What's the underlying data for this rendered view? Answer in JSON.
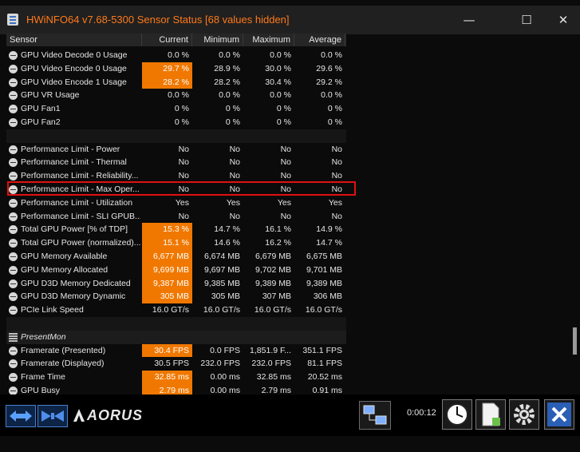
{
  "window": {
    "title": "HWiNFO64 v7.68-5300 Sensor Status [68 values hidden]",
    "minimize_glyph": "—",
    "maximize_glyph": "☐",
    "close_glyph": "✕"
  },
  "table": {
    "headers": {
      "sensor": "Sensor",
      "current": "Current",
      "minimum": "Minimum",
      "maximum": "Maximum",
      "average": "Average"
    },
    "rows": [
      {
        "name": "GPU Video Decode 0 Usage",
        "current": "0.0 %",
        "minimum": "0.0 %",
        "maximum": "0.0 %",
        "average": "0.0 %",
        "hl": false
      },
      {
        "name": "GPU Video Encode 0 Usage",
        "current": "29.7 %",
        "minimum": "28.9 %",
        "maximum": "30.0 %",
        "average": "29.6 %",
        "hl": true
      },
      {
        "name": "GPU Video Encode 1 Usage",
        "current": "28.2 %",
        "minimum": "28.2 %",
        "maximum": "30.4 %",
        "average": "29.2 %",
        "hl": true
      },
      {
        "name": "GPU VR Usage",
        "current": "0.0 %",
        "minimum": "0.0 %",
        "maximum": "0.0 %",
        "average": "0.0 %",
        "hl": false
      },
      {
        "name": "GPU Fan1",
        "current": "0 %",
        "minimum": "0 %",
        "maximum": "0 %",
        "average": "0 %",
        "hl": false
      },
      {
        "name": "GPU Fan2",
        "current": "0 %",
        "minimum": "0 %",
        "maximum": "0 %",
        "average": "0 %",
        "hl": false
      },
      {
        "name": "",
        "current": "",
        "minimum": "",
        "maximum": "",
        "average": "",
        "hl": false,
        "blank": true
      },
      {
        "name": "Performance Limit - Power",
        "current": "No",
        "minimum": "No",
        "maximum": "No",
        "average": "No",
        "hl": false
      },
      {
        "name": "Performance Limit - Thermal",
        "current": "No",
        "minimum": "No",
        "maximum": "No",
        "average": "No",
        "hl": false
      },
      {
        "name": "Performance Limit - Reliability...",
        "current": "No",
        "minimum": "No",
        "maximum": "No",
        "average": "No",
        "hl": false
      },
      {
        "name": "Performance Limit - Max Oper...",
        "current": "No",
        "minimum": "No",
        "maximum": "No",
        "average": "No",
        "hl": false
      },
      {
        "name": "Performance Limit - Utilization",
        "current": "Yes",
        "minimum": "Yes",
        "maximum": "Yes",
        "average": "Yes",
        "hl": false
      },
      {
        "name": "Performance Limit - SLI GPUB...",
        "current": "No",
        "minimum": "No",
        "maximum": "No",
        "average": "No",
        "hl": false
      },
      {
        "name": "Total GPU Power [% of TDP]",
        "current": "15.3 %",
        "minimum": "14.7 %",
        "maximum": "16.1 %",
        "average": "14.9 %",
        "hl": true
      },
      {
        "name": "Total GPU Power (normalized)...",
        "current": "15.1 %",
        "minimum": "14.6 %",
        "maximum": "16.2 %",
        "average": "14.7 %",
        "hl": true
      },
      {
        "name": "GPU Memory Available",
        "current": "6,677 MB",
        "minimum": "6,674 MB",
        "maximum": "6,679 MB",
        "average": "6,675 MB",
        "hl": true
      },
      {
        "name": "GPU Memory Allocated",
        "current": "9,699 MB",
        "minimum": "9,697 MB",
        "maximum": "9,702 MB",
        "average": "9,701 MB",
        "hl": true
      },
      {
        "name": "GPU D3D Memory Dedicated",
        "current": "9,387 MB",
        "minimum": "9,385 MB",
        "maximum": "9,389 MB",
        "average": "9,389 MB",
        "hl": true
      },
      {
        "name": "GPU D3D Memory Dynamic",
        "current": "305 MB",
        "minimum": "305 MB",
        "maximum": "307 MB",
        "average": "306 MB",
        "hl": true
      },
      {
        "name": "PCIe Link Speed",
        "current": "16.0 GT/s",
        "minimum": "16.0 GT/s",
        "maximum": "16.0 GT/s",
        "average": "16.0 GT/s",
        "hl": false
      },
      {
        "name": "",
        "current": "",
        "minimum": "",
        "maximum": "",
        "average": "",
        "hl": false,
        "blank": true
      },
      {
        "name": "PresentMon",
        "current": "",
        "minimum": "",
        "maximum": "",
        "average": "",
        "hl": false,
        "group": true
      },
      {
        "name": "Framerate (Presented)",
        "current": "30.4 FPS",
        "minimum": "0.0 FPS",
        "maximum": "1,851.9 F...",
        "average": "351.1 FPS",
        "hl": true
      },
      {
        "name": "Framerate (Displayed)",
        "current": "30.5 FPS",
        "minimum": "232.0 FPS",
        "maximum": "232.0 FPS",
        "average": "81.1 FPS",
        "hl": false
      },
      {
        "name": "Frame Time",
        "current": "32.85 ms",
        "minimum": "0.00 ms",
        "maximum": "32.85 ms",
        "average": "20.52 ms",
        "hl": true
      },
      {
        "name": "GPU Busy",
        "current": "2.79 ms",
        "minimum": "0.00 ms",
        "maximum": "2.79 ms",
        "average": "0.91 ms",
        "hl": true
      }
    ]
  },
  "footer": {
    "logo_text": "AORUS",
    "timer": "0:00:12",
    "icons": [
      "expand-arrows-icon",
      "collapse-arrows-icon",
      "network-icon",
      "clock-icon",
      "report-icon",
      "settings-gear-icon",
      "close-x-icon"
    ]
  },
  "colors": {
    "title": "#ff7a1a",
    "highlight": "#f07800",
    "selection_border": "#e01010"
  }
}
